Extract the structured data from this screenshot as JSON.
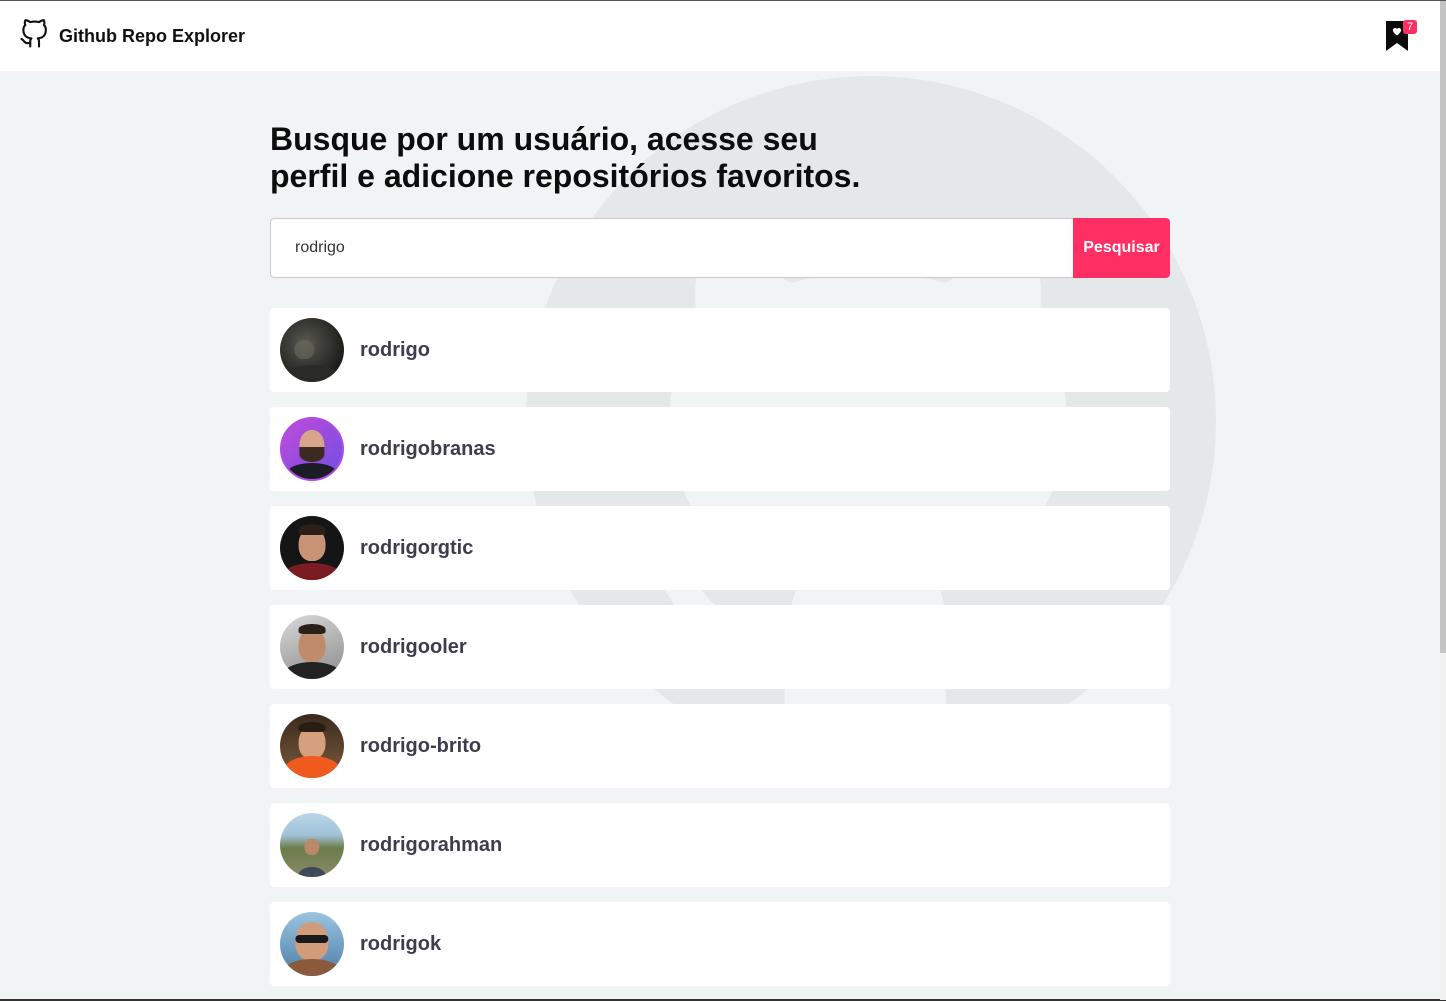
{
  "header": {
    "app_title": "Github Repo Explorer",
    "favorites_count": "7"
  },
  "main": {
    "headline_line1": "Busque por um usuário, acesse seu",
    "headline_line2": "perfil e adicione repositórios favoritos.",
    "search_value": "rodrigo",
    "search_button_label": "Pesquisar"
  },
  "users": [
    {
      "login": "rodrigo"
    },
    {
      "login": "rodrigobranas"
    },
    {
      "login": "rodrigorgtic"
    },
    {
      "login": "rodrigooler"
    },
    {
      "login": "rodrigo-brito"
    },
    {
      "login": "rodrigorahman"
    },
    {
      "login": "rodrigok"
    }
  ],
  "colors": {
    "accent": "#ff2e63",
    "background": "#f0f4f4",
    "card": "#ffffff",
    "username_text": "#3d3d4d"
  },
  "icons": {
    "brand": "github-icon",
    "favorites": "bookmark-heart-icon"
  }
}
